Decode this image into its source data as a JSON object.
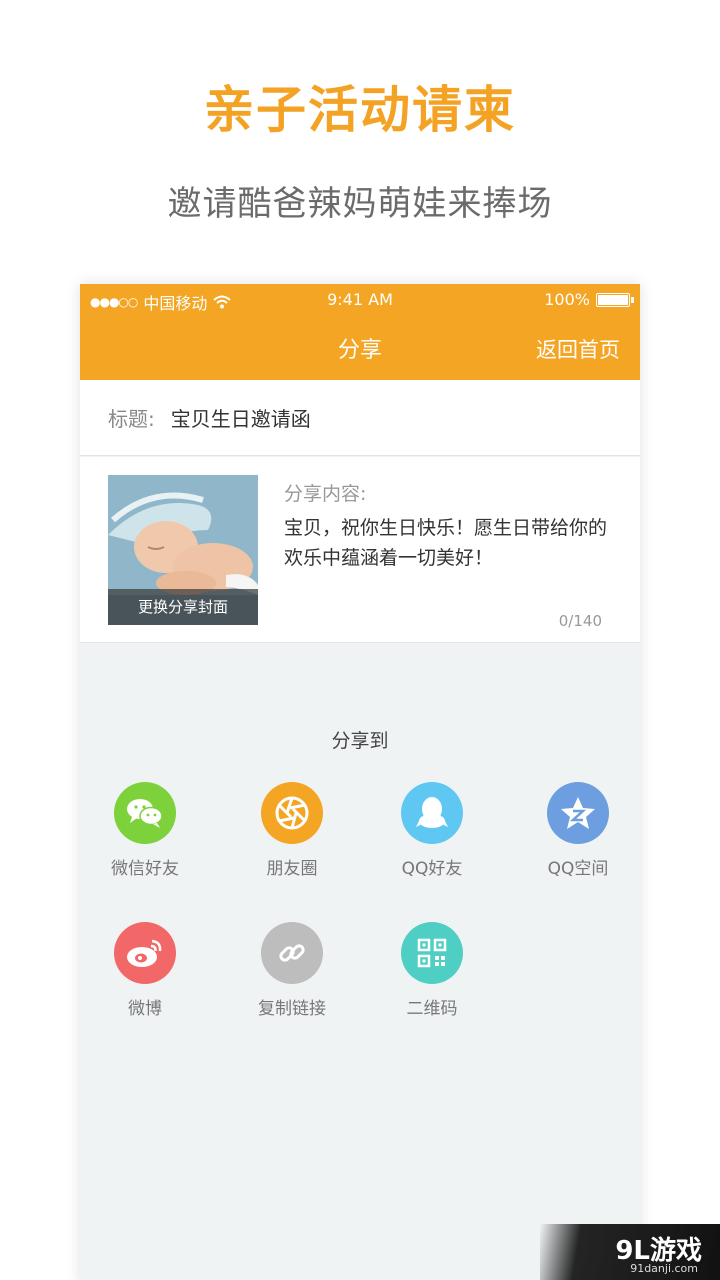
{
  "promo": {
    "title": "亲子活动请柬",
    "subtitle": "邀请酷爸辣妈萌娃来捧场"
  },
  "status_bar": {
    "signal": "●●●○○",
    "carrier": "中国移动",
    "time": "9:41 AM",
    "battery": "100%"
  },
  "nav": {
    "title": "分享",
    "right_button": "返回首页"
  },
  "form": {
    "title_label": "标题:",
    "title_value": "宝贝生日邀请函",
    "content_label": "分享内容:",
    "content_text": "宝贝，祝你生日快乐！愿生日带给你的欢乐中蕴涵着一切美好！",
    "counter": "0/140",
    "cover_button": "更换分享封面"
  },
  "share": {
    "heading": "分享到",
    "targets": [
      {
        "label": "微信好友",
        "icon": "wechat-icon",
        "color": "#7dd13a"
      },
      {
        "label": "朋友圈",
        "icon": "moments-icon",
        "color": "#f4a523"
      },
      {
        "label": "QQ好友",
        "icon": "qq-icon",
        "color": "#5ec8f2"
      },
      {
        "label": "QQ空间",
        "icon": "qzone-icon",
        "color": "#6d9fe0"
      },
      {
        "label": "微博",
        "icon": "weibo-icon",
        "color": "#f26767"
      },
      {
        "label": "复制链接",
        "icon": "link-icon",
        "color": "#bdbdbd"
      },
      {
        "label": "二维码",
        "icon": "qrcode-icon",
        "color": "#4fcfc4"
      }
    ]
  },
  "watermark": {
    "logo": "9L游戏",
    "url": "91danji.com"
  },
  "colors": {
    "accent": "#f4a524",
    "background": "#f0f3f4"
  }
}
